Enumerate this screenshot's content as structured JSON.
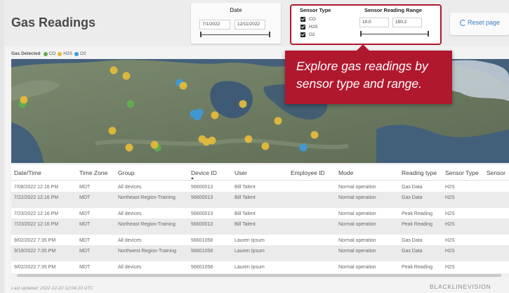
{
  "page": {
    "title": "Gas Readings"
  },
  "date_filter": {
    "label": "Date",
    "start": "7/1/2022",
    "end": "12/11/2022"
  },
  "sensor_filter": {
    "type_label": "Sensor Type",
    "types": [
      {
        "label": "CO",
        "checked": true
      },
      {
        "label": "H2S",
        "checked": true
      },
      {
        "label": "O2",
        "checked": true
      }
    ],
    "range_label": "Sensor Reading Range",
    "range_min": "10.0",
    "range_max": "150.2"
  },
  "reset": {
    "label": "Reset page",
    "icon": "reset-icon"
  },
  "legend": {
    "title": "Gas Detected",
    "items": [
      {
        "label": "CO",
        "color": "#5fae4d"
      },
      {
        "label": "H2S",
        "color": "#e3b93b"
      },
      {
        "label": "O2",
        "color": "#3d9ad8"
      }
    ]
  },
  "callout": {
    "text": "Explore gas readings by sensor type and range."
  },
  "table": {
    "columns": [
      "Date/Time",
      "Time Zone",
      "Group",
      "Device ID",
      "User",
      "Employee ID",
      "Mode",
      "Reading type",
      "Sensor Type",
      "Sensor"
    ],
    "rows": [
      [
        "7/08/2022 12:16 PM",
        "MDT",
        "All devices",
        "56600013",
        "Bill Talent",
        "",
        "Normal operation",
        "Gas Data",
        "H2S"
      ],
      [
        "7/22/2022 12:16 PM",
        "MDT",
        "Northeast Region-Training",
        "56600013",
        "Bill Talent",
        "",
        "Normal operation",
        "Gas Data",
        "H2S"
      ],
      [
        "7/23/2022 12:16 PM",
        "MDT",
        "All devices",
        "56600013",
        "Bill Talent",
        "",
        "Normal operation",
        "Peak Reading",
        "H2S"
      ],
      [
        "7/23/2022 12:16 PM",
        "MDT",
        "Northeast Region-Training",
        "56600013",
        "Bill Talent",
        "",
        "Normal operation",
        "Peak Reading",
        "H2S"
      ],
      [
        "9/02/2022 7:35 PM",
        "MDT",
        "All devices",
        "56601058",
        "Lauren Ipsum",
        "",
        "Normal operation",
        "Gas Data",
        "H2S"
      ],
      [
        "9/19/2022 7:35 PM",
        "MDT",
        "Northwest Region-Training",
        "56601058",
        "Lauren Ipsum",
        "",
        "Normal operation",
        "Gas Data",
        "H2S"
      ],
      [
        "9/02/2022 7:35 PM",
        "MDT",
        "All devices",
        "56601058",
        "Lauren Ipsum",
        "",
        "Normal operation",
        "Peak Reading",
        "H2S"
      ]
    ]
  },
  "footer": {
    "last_updated": "Last updated: 2022-12-22 12:04:23 UTC",
    "brand": "BLACKLINEVISION"
  }
}
